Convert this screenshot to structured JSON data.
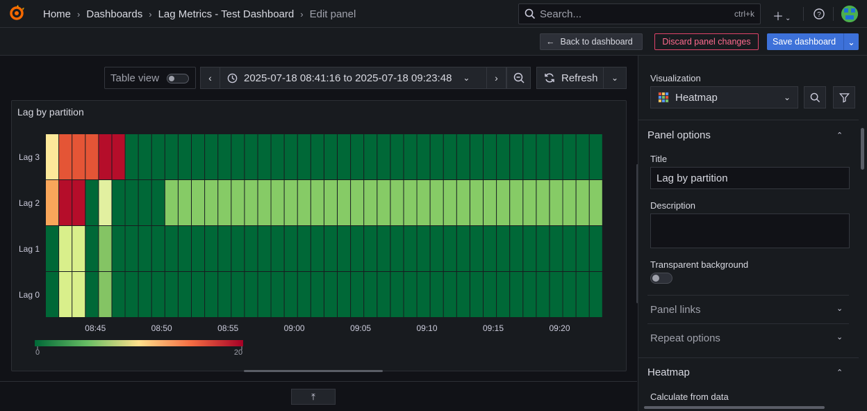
{
  "breadcrumb": {
    "home": "Home",
    "dashboards": "Dashboards",
    "dashboard": "Lag Metrics - Test Dashboard",
    "current": "Edit panel"
  },
  "search": {
    "placeholder": "Search...",
    "shortcut": "ctrl+k"
  },
  "actions": {
    "back": "Back to dashboard",
    "discard": "Discard panel changes",
    "save": "Save dashboard"
  },
  "toolbar": {
    "table_view": "Table view",
    "time_range": "2025-07-18 08:41:16 to 2025-07-18 09:23:48",
    "refresh": "Refresh"
  },
  "panel": {
    "title": "Lag by partition"
  },
  "chart_data": {
    "type": "heatmap",
    "title": "Lag by partition",
    "rows": [
      "Lag 3",
      "Lag 2",
      "Lag 1",
      "Lag 0"
    ],
    "x_ticks": [
      "08:45",
      "08:50",
      "08:55",
      "09:00",
      "09:05",
      "09:10",
      "09:15",
      "09:20"
    ],
    "x_range": [
      "08:41:16",
      "09:23:48"
    ],
    "cell_minutes": 1,
    "color_scale": {
      "min": 0,
      "max": 20,
      "scheme": "RdYlGn (reversed)",
      "min_label": "0",
      "max_label": "20"
    },
    "values": {
      "Lag 3": [
        9,
        15,
        16,
        16,
        19,
        20,
        0,
        0,
        0,
        0,
        0,
        0,
        0,
        0,
        0,
        0,
        0,
        0,
        0,
        0,
        0,
        0,
        0,
        0,
        0,
        0,
        0,
        0,
        0,
        0,
        0,
        0,
        0,
        0,
        0,
        0,
        0,
        0,
        0,
        0,
        0,
        0
      ],
      "Lag 2": [
        13,
        19,
        19,
        1,
        8,
        1,
        1,
        1,
        1,
        4,
        4,
        4,
        4,
        4,
        4,
        4,
        4,
        4,
        4,
        4,
        4,
        4,
        4,
        4,
        4,
        4,
        4,
        4,
        4,
        4,
        4,
        4,
        4,
        4,
        4,
        4,
        4,
        4,
        4,
        4,
        4,
        4
      ],
      "Lag 1": [
        1,
        7,
        7,
        1,
        5,
        1,
        0,
        0,
        0,
        0,
        0,
        0,
        0,
        0,
        0,
        0,
        0,
        0,
        0,
        0,
        0,
        0,
        0,
        0,
        0,
        0,
        0,
        0,
        0,
        0,
        0,
        0,
        0,
        0,
        0,
        0,
        0,
        0,
        0,
        0,
        0,
        0
      ],
      "Lag 0": [
        1,
        7,
        7,
        1,
        5,
        1,
        0,
        0,
        0,
        0,
        0,
        0,
        0,
        0,
        0,
        0,
        0,
        0,
        0,
        0,
        0,
        0,
        0,
        0,
        0,
        0,
        0,
        0,
        0,
        0,
        0,
        0,
        0,
        0,
        0,
        0,
        0,
        0,
        0,
        0,
        0,
        0
      ]
    },
    "cell_colors": {
      "Lag 3": [
        "#fde99a",
        "#e45536",
        "#e45536",
        "#e45536",
        "#b50d2a",
        "#b50d2a",
        "#006837"
      ],
      "Lag 2": [
        "#f9a65a",
        "#b50d2a",
        "#b50d2a",
        "#006837",
        "#e2f0a0",
        "#006837",
        "#006837",
        "#006837",
        "#006837",
        "#86cb66"
      ],
      "Lag 1": [
        "#006837",
        "#d9ef8b",
        "#d9ef8b",
        "#006837",
        "#84c464",
        "#006837"
      ],
      "Lag 0": [
        "#006837",
        "#d9ef8b",
        "#d9ef8b",
        "#006837",
        "#84c464",
        "#006837"
      ]
    }
  },
  "side": {
    "visualization_label": "Visualization",
    "visualization": "Heatmap",
    "panel_options": "Panel options",
    "title_label": "Title",
    "title_value": "Lag by partition",
    "description_label": "Description",
    "description_value": "",
    "transparent_label": "Transparent background",
    "panel_links": "Panel links",
    "repeat_options": "Repeat options",
    "heatmap_section": "Heatmap",
    "calculate": "Calculate from data"
  }
}
